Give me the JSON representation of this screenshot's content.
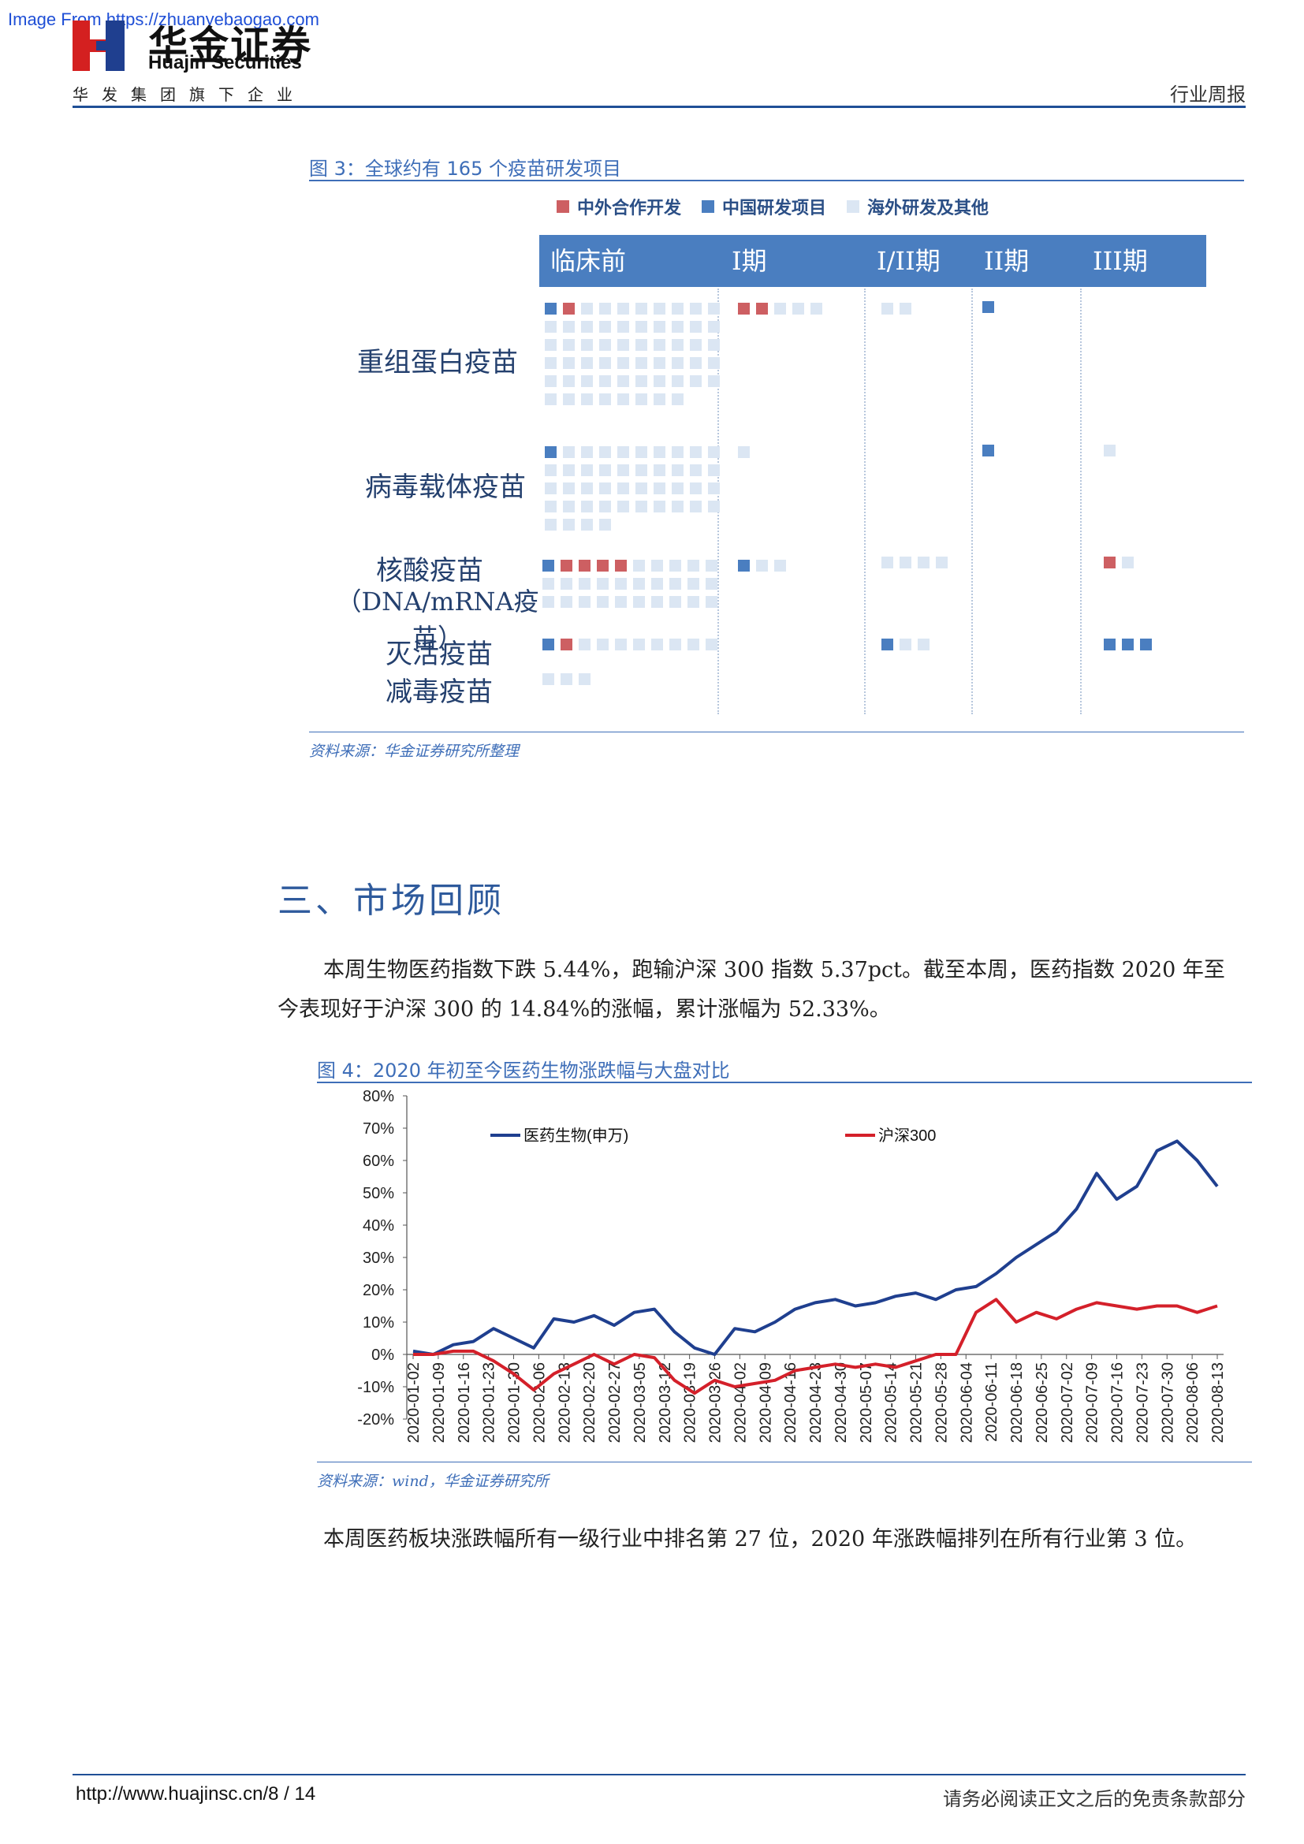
{
  "watermark": "Image From https://zhuanyebaogao.com",
  "header": {
    "logo_cn": "华金证券",
    "logo_en": "Huajin Securities",
    "logo_sub": "华发集团旗下企业",
    "doc_type": "行业周报"
  },
  "figure3": {
    "caption": "图 3：全球约有 165 个疫苗研发项目",
    "legend": [
      {
        "label": "中外合作开发",
        "color": "#cd5f62"
      },
      {
        "label": "中国研发项目",
        "color": "#4a7ec0"
      },
      {
        "label": "海外研发及其他",
        "color": "#dbe6f3"
      }
    ],
    "phases": [
      "临床前",
      "I期",
      "I/II期",
      "II期",
      "III期"
    ],
    "vaccine_types": [
      {
        "label": "重组蛋白疫苗",
        "label2": ""
      },
      {
        "label": "病毒载体疫苗",
        "label2": ""
      },
      {
        "label": "核酸疫苗",
        "label2": "（DNA/mRNA疫苗）"
      },
      {
        "label": "灭活疫苗",
        "label2": "减毒疫苗"
      }
    ],
    "source": "资料来源：华金证券研究所整理"
  },
  "section": {
    "title": "三、市场回顾",
    "para1_line1": "本周生物医药指数下跌 5.44%，跑输沪深 300 指数 5.37pct。截至本周，医药指数 2020 年至",
    "para1_line2": "今表现好于沪深 300 的 14.84%的涨幅，累计涨幅为 52.33%。",
    "para2": "本周医药板块涨跌幅所有一级行业中排名第 27 位，2020 年涨跌幅排列在所有行业第 3 位。"
  },
  "figure4": {
    "caption": "图 4：2020 年初至今医药生物涨跌幅与大盘对比",
    "source": "资料来源：wind，华金证券研究所"
  },
  "chart_data": {
    "type": "line",
    "title": "",
    "xlabel": "",
    "ylabel": "",
    "ylim": [
      -0.2,
      0.8
    ],
    "y_ticks": [
      "80%",
      "70%",
      "60%",
      "50%",
      "40%",
      "30%",
      "20%",
      "10%",
      "0%",
      "-10%",
      "-20%"
    ],
    "x_ticks": [
      "2020-01-02",
      "2020-01-09",
      "2020-01-16",
      "2020-01-23",
      "2020-01-30",
      "2020-02-06",
      "2020-02-13",
      "2020-02-20",
      "2020-02-27",
      "2020-03-05",
      "2020-03-12",
      "2020-03-19",
      "2020-03-26",
      "2020-04-02",
      "2020-04-09",
      "2020-04-16",
      "2020-04-23",
      "2020-04-30",
      "2020-05-07",
      "2020-05-14",
      "2020-05-21",
      "2020-05-28",
      "2020-06-04",
      "2020-06-11",
      "2020-06-18",
      "2020-06-25",
      "2020-07-02",
      "2020-07-09",
      "2020-07-16",
      "2020-07-23",
      "2020-07-30",
      "2020-08-06",
      "2020-08-13"
    ],
    "legend_position": "top",
    "grid": false,
    "series": [
      {
        "name": "医药生物(申万)",
        "color": "#1f3f8f",
        "values": [
          0.01,
          0.0,
          0.03,
          0.04,
          0.08,
          0.05,
          0.02,
          0.11,
          0.1,
          0.12,
          0.09,
          0.13,
          0.14,
          0.07,
          0.02,
          0.0,
          0.08,
          0.07,
          0.1,
          0.14,
          0.16,
          0.17,
          0.15,
          0.16,
          0.18,
          0.19,
          0.17,
          0.2,
          0.21,
          0.25,
          0.3,
          0.34,
          0.38,
          0.45,
          0.56,
          0.48,
          0.52,
          0.63,
          0.66,
          0.6,
          0.52
        ]
      },
      {
        "name": "沪深300",
        "color": "#d4202a",
        "values": [
          0.0,
          0.0,
          0.01,
          0.01,
          -0.02,
          -0.06,
          -0.11,
          -0.06,
          -0.03,
          0.0,
          -0.03,
          0.0,
          -0.01,
          -0.08,
          -0.12,
          -0.08,
          -0.1,
          -0.09,
          -0.08,
          -0.05,
          -0.04,
          -0.03,
          -0.04,
          -0.03,
          -0.04,
          -0.02,
          0.0,
          0.0,
          0.13,
          0.17,
          0.1,
          0.13,
          0.11,
          0.14,
          0.16,
          0.15,
          0.14,
          0.15,
          0.15,
          0.13,
          0.15
        ]
      }
    ]
  }
}
